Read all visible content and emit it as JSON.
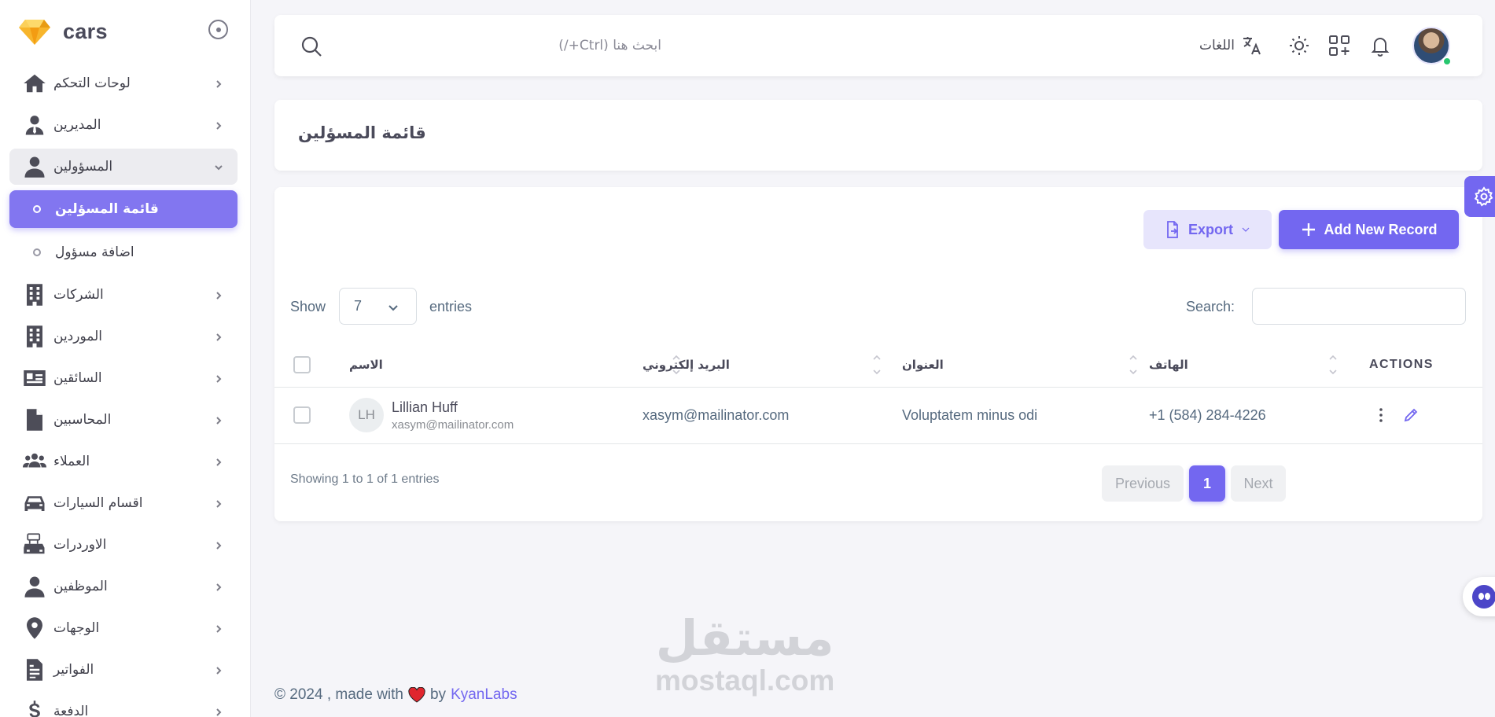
{
  "app": {
    "brand_name": "cars"
  },
  "sidebar": {
    "items": [
      {
        "label": "لوحات التحكم",
        "icon": "home-icon"
      },
      {
        "label": "المديرين",
        "icon": "user-tie-icon"
      },
      {
        "label": "المسؤولين",
        "icon": "user-icon",
        "open": true
      },
      {
        "label": "قائمة المسؤلين",
        "sub": true,
        "active": true
      },
      {
        "label": "اضافة مسؤول",
        "sub": true
      },
      {
        "label": "الشركات",
        "icon": "building-icon"
      },
      {
        "label": "الموردين",
        "icon": "building-icon"
      },
      {
        "label": "السائقين",
        "icon": "id-card-icon"
      },
      {
        "label": "المحاسبين",
        "icon": "file-icon"
      },
      {
        "label": "العملاء",
        "icon": "users-icon"
      },
      {
        "label": "اقسام السيارات",
        "icon": "car-icon"
      },
      {
        "label": "الاوردرات",
        "icon": "rent-car-icon"
      },
      {
        "label": "الموظفين",
        "icon": "user-icon"
      },
      {
        "label": "الوجهات",
        "icon": "map-pin-icon"
      },
      {
        "label": "الفواتير",
        "icon": "invoice-icon"
      },
      {
        "label": "الدفعة",
        "icon": "dollar-icon"
      }
    ]
  },
  "navbar": {
    "search_placeholder": "ابحث هنا (Ctrl+/)",
    "languages_label": "اللغات"
  },
  "page": {
    "title": "قائمة المسؤلين"
  },
  "table": {
    "export_label": "Export",
    "add_label": "Add New Record",
    "show_label": "Show",
    "entries_value": "7",
    "entries_label": "entries",
    "search_label": "Search:",
    "columns": [
      "الاسم",
      "البريد إلكتروني",
      "العنوان",
      "الهاتف",
      "ACTIONS"
    ],
    "rows": [
      {
        "initials": "LH",
        "name": "Lillian Huff",
        "sub_email": "xasym@mailinator.com",
        "email": "xasym@mailinator.com",
        "address": "Voluptatem minus odi",
        "phone": "+1 (584) 284-4226"
      }
    ],
    "showing": "Showing 1 to 1 of 1 entries",
    "pagination": {
      "previous": "Previous",
      "current": "1",
      "next": "Next"
    }
  },
  "footer": {
    "prefix": "© 2024 , made with",
    "by": "by",
    "link": "KyanLabs"
  },
  "watermark": {
    "arabic": "مستقل",
    "english": "mostaql.com"
  },
  "colors": {
    "primary": "#7367f0",
    "active_bg": "#8276f0",
    "status_online": "#28c76f",
    "heart": "#e0262e"
  }
}
